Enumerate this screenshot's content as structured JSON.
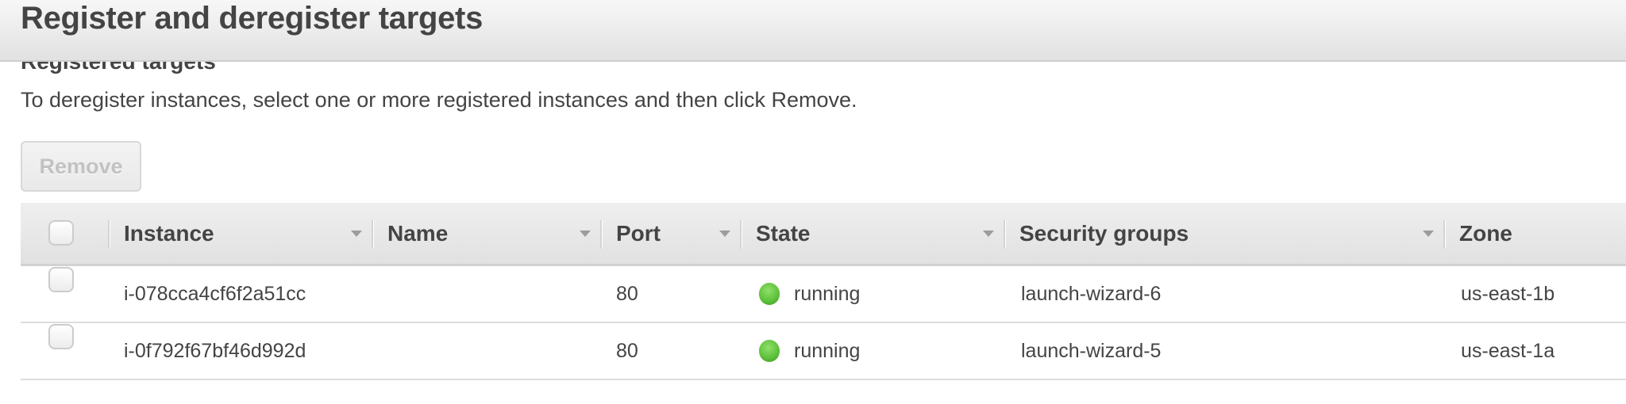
{
  "modal": {
    "title": "Register and deregister targets"
  },
  "section": {
    "subheading": "Registered targets",
    "instructions": "To deregister instances, select one or more registered instances and then click Remove."
  },
  "toolbar": {
    "remove_label": "Remove",
    "remove_enabled": false
  },
  "table": {
    "columns": [
      {
        "key": "instance",
        "label": "Instance",
        "sortable": true
      },
      {
        "key": "name",
        "label": "Name",
        "sortable": true
      },
      {
        "key": "port",
        "label": "Port",
        "sortable": true
      },
      {
        "key": "state",
        "label": "State",
        "sortable": true
      },
      {
        "key": "security_groups",
        "label": "Security groups",
        "sortable": true
      },
      {
        "key": "zone",
        "label": "Zone",
        "sortable": false
      }
    ],
    "rows": [
      {
        "selected": false,
        "instance": "i-078cca4cf6f2a51cc",
        "name": "",
        "port": "80",
        "state": "running",
        "state_icon": "green-status-dot",
        "security_groups": "launch-wizard-6",
        "zone": "us-east-1b"
      },
      {
        "selected": false,
        "instance": "i-0f792f67bf46d992d",
        "name": "",
        "port": "80",
        "state": "running",
        "state_icon": "green-status-dot",
        "security_groups": "launch-wizard-5",
        "zone": "us-east-1a"
      }
    ]
  },
  "colors": {
    "running": "#5fc23c",
    "header_bg": "#e6e6e6",
    "text": "#444444",
    "disabled_text": "#c2c2c2"
  }
}
